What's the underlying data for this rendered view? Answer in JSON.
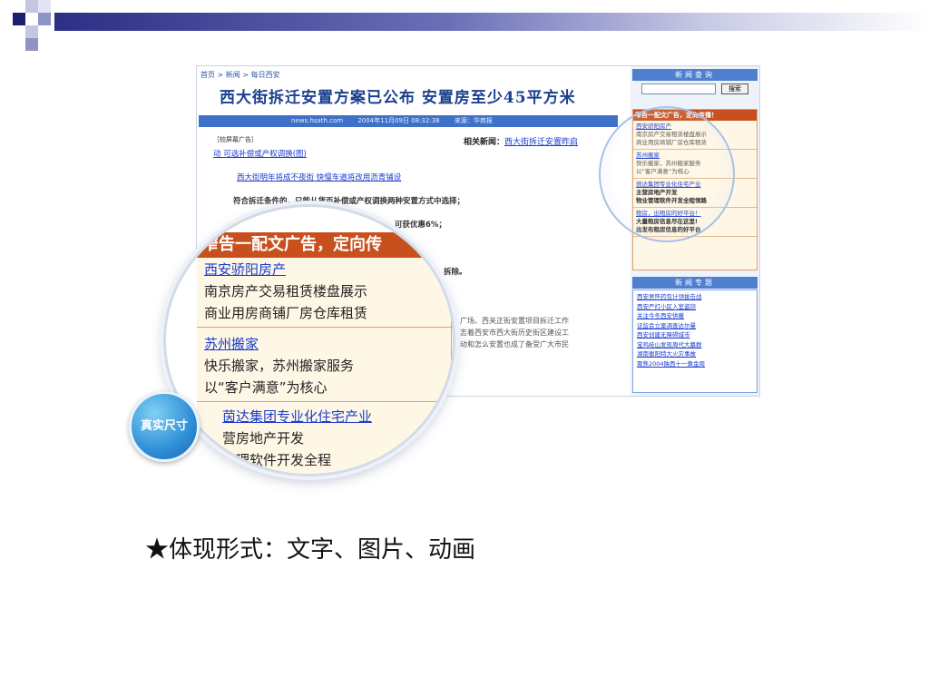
{
  "colors": {
    "header_gradient_start": "#2b2f86",
    "link_blue": "#1a3ccf",
    "ad_orange": "#c8501e",
    "badge_blue": "#2f8fd6"
  },
  "screenshot": {
    "breadcrumb": "首页 > 新闻 > 每日西安",
    "headline": "西大街拆迁安置方案已公布  安置房至少45平方米",
    "meta": {
      "source_site": "news.hsath.com",
      "datetime": "2004年11月09日 08:32:38",
      "source": "来源：华商报"
    },
    "ad_label": "［较屏幕广告］",
    "related_label": "相关新闻：",
    "related_link": "西大街拆迁安置昨启",
    "lines": [
      "动 可选补偿或产权调换(图)",
      "西大街明年将成不夜街 快慢车道将改用沥青铺设",
      "符合拆迁条件的，只能从货币补偿或产权调换两种安置方式中选择；",
      "可获优惠6%；",
      "拆除。",
      "广场、西关正街安置项目拆迁工作",
      "志着西安市西大街历史街区建设工",
      "动和怎么安置也成了备受广大市民"
    ],
    "sidebar": {
      "search_title": "新闻查询",
      "search_button": "搜索",
      "ad_title": "窄告一配文广告，定向传播！",
      "ads": [
        {
          "title": "西安骄阳房产",
          "line1": "南京房产交易租赁楼盘展示",
          "line2": "商业用房商铺厂房仓库租赁"
        },
        {
          "title": "苏州搬家",
          "line1": "快乐搬家，苏州搬家服务",
          "line2": "以“客户满意”为核心"
        },
        {
          "title": "茵达集团专业化住宅产业",
          "line1": "主营房地产开发",
          "line2": "物业管理软件开发全程领路"
        },
        {
          "title": "租房，出租房的好平台！",
          "line1": "大量租房信息尽在这里!",
          "line2": "出发布租房信息的好平台"
        }
      ],
      "news_title": "新闻专题",
      "news_items": [
        "西安男怀药包计领拔击战",
        "西安严打小区入室盗窃",
        "关注今冬西安供暖",
        "证监会立案调查达尔曼",
        "西安创建无障碍城市",
        "宝鸡岐山发现周代大墓群",
        "湖南衡阳特大火灾事故",
        "聚焦2004陕西十一黄金周"
      ]
    }
  },
  "magnifier": {
    "title": "窄告一配文广告，定向传",
    "items": [
      {
        "title": "西安骄阳房产",
        "line1": "南京房产交易租赁楼盘展示",
        "line2": "商业用房商铺厂房仓库租赁"
      },
      {
        "title": "苏州搬家",
        "line1": "快乐搬家，苏州搬家服务",
        "line2": "以“客户满意”为核心"
      },
      {
        "title": "茵达集团专业化住宅产业",
        "line1": "营房地产开发",
        "line2": "管理软件开发全程"
      }
    ]
  },
  "badge": "真实尺寸",
  "caption": "★体现形式：文字、图片、动画"
}
